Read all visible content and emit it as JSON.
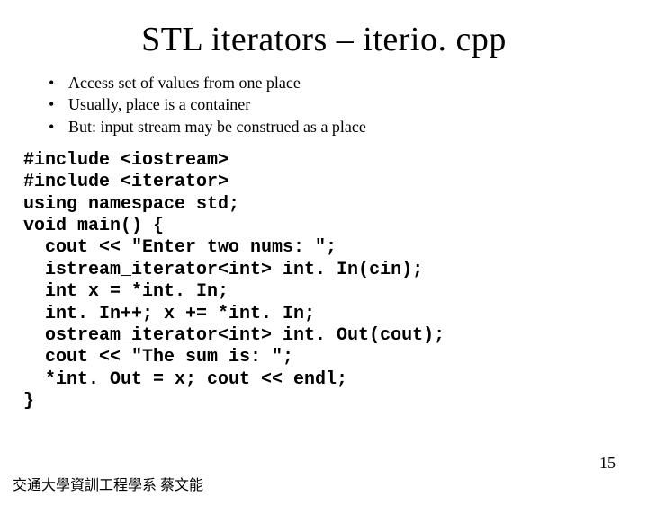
{
  "title": "STL iterators – iterio. cpp",
  "bullets": [
    "Access set of values from one place",
    "Usually, place is a container",
    "But: input stream may be construed as a place"
  ],
  "code_lines": [
    "#include <iostream>",
    "#include <iterator>",
    "using namespace std;",
    "void main() {",
    "  cout << \"Enter two nums: \";",
    "  istream_iterator<int> int. In(cin);",
    "  int x = *int. In;",
    "  int. In++; x += *int. In;",
    "  ostream_iterator<int> int. Out(cout);",
    "  cout << \"The sum is: \";",
    "  *int. Out = x; cout << endl;",
    "}"
  ],
  "footer": "交通大學資訓工程學系 蔡文能",
  "page_number": "15"
}
